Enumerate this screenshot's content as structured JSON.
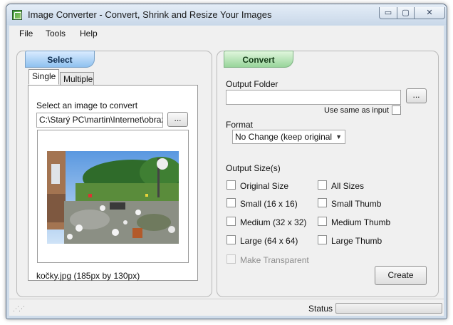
{
  "window": {
    "title": "Image Converter - Convert, Shrink and Resize Your Images",
    "icon": "image-converter-icon",
    "minimize_glyph": "▭",
    "maximize_glyph": "▢",
    "close_glyph": "✕"
  },
  "menu": {
    "items": [
      "File",
      "Tools",
      "Help"
    ]
  },
  "select_panel": {
    "tab_label": "Select",
    "tabs": [
      "Single",
      "Multiple"
    ],
    "prompt": "Select an image to convert",
    "path_value": "C:\\Starý PC\\martin\\Internet\\obrazky",
    "browse_label": "...",
    "image_caption": "kočky.jpg (185px by 130px)"
  },
  "convert_panel": {
    "tab_label": "Convert",
    "output_folder_label": "Output Folder",
    "output_folder_value": "",
    "browse_label": "...",
    "use_same_label": "Use same as input",
    "format_label": "Format",
    "format_value": "No Change (keep original format)",
    "output_sizes_label": "Output Size(s)",
    "sizes_left": [
      "Original Size",
      "Small (16 x 16)",
      "Medium (32 x 32)",
      "Large (64 x 64)"
    ],
    "sizes_right": [
      "All Sizes",
      "Small Thumb",
      "Medium Thumb",
      "Large Thumb"
    ],
    "make_transparent_label": "Make Transparent",
    "create_label": "Create"
  },
  "status": {
    "label": "Status",
    "progress": 0
  },
  "colors": {
    "select_tab": "#8fc1ef",
    "convert_tab": "#98d59a",
    "window_frame": "#cfdcea"
  }
}
